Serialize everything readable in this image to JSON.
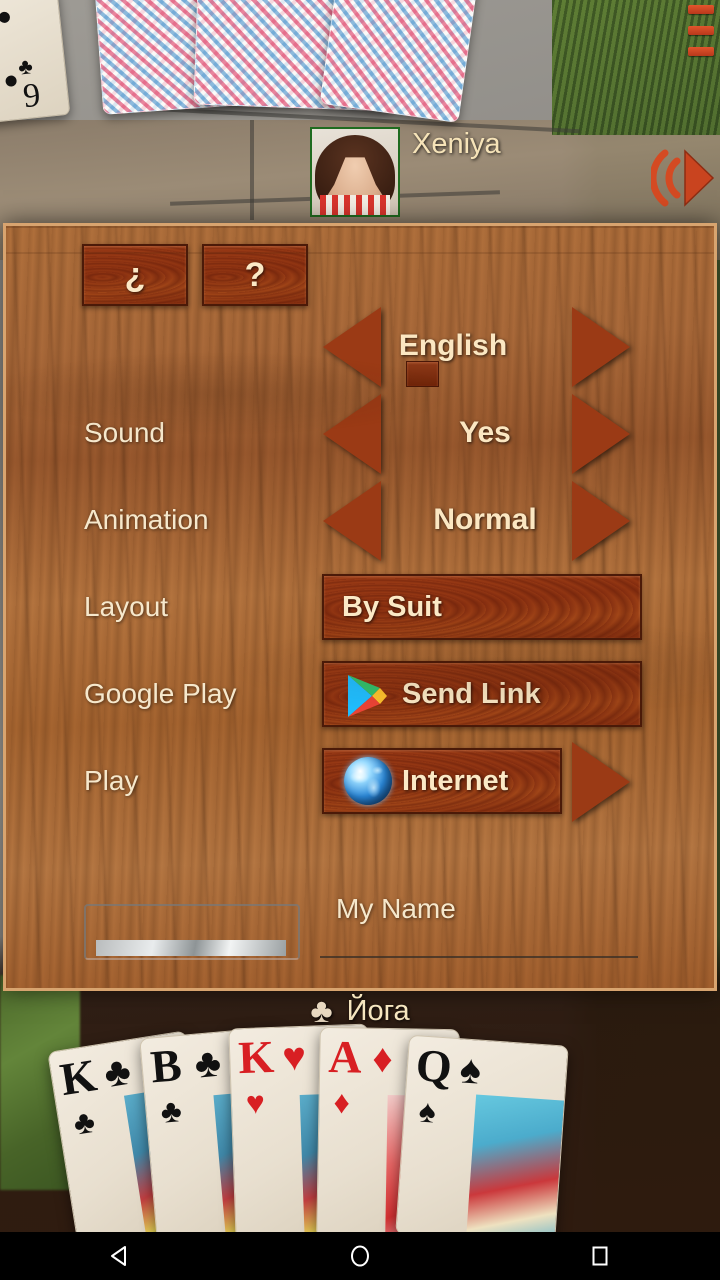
{
  "app": {
    "opponent": {
      "name": "Xeniya"
    },
    "my_player": {
      "suit_glyph": "♣",
      "nickname": "Йога"
    },
    "icons": {
      "menu": "hamburger-menu-icon",
      "sound": "speaker-icon",
      "google_play": "google-play-icon",
      "globe": "globe-icon"
    }
  },
  "settings_panel": {
    "help_buttons": [
      {
        "id": "about-button",
        "label": "¿"
      },
      {
        "id": "help-button",
        "label": "?"
      }
    ],
    "rows": [
      {
        "id": "language",
        "label": "",
        "value": "English",
        "type": "stepper",
        "prev": "◀",
        "next": "▶"
      },
      {
        "id": "sound",
        "label": "Sound",
        "value": "Yes",
        "type": "stepper",
        "prev": "◀",
        "next": "▶"
      },
      {
        "id": "animation",
        "label": "Animation",
        "value": "Normal",
        "type": "stepper",
        "prev": "◀",
        "next": "▶"
      },
      {
        "id": "layout",
        "label": "Layout",
        "value": "By Suit",
        "type": "button"
      },
      {
        "id": "google-play",
        "label": "Google Play",
        "value": "Send Link",
        "type": "button-icon"
      },
      {
        "id": "play",
        "label": "Play",
        "value": "Internet",
        "type": "button-icon-arrow",
        "next": "▶"
      }
    ],
    "profile": {
      "name_label": "My Name",
      "name_value": "",
      "name_placeholder": ""
    }
  },
  "table_cards": [
    {
      "rank": "K",
      "suit": "♣",
      "color": "black"
    },
    {
      "rank": "B",
      "suit": "♣",
      "color": "black"
    },
    {
      "rank": "K",
      "suit": "♥",
      "color": "red"
    },
    {
      "rank": "A",
      "suit": "♦",
      "color": "red"
    },
    {
      "rank": "Q",
      "suit": "♠",
      "color": "black"
    }
  ],
  "navbar": {
    "back": "back-button",
    "home": "home-button",
    "recents": "recents-button"
  },
  "colors": {
    "panel_border": "#d8a46f",
    "label_text": "#f6e8cc",
    "button_wood": "#9c3c16",
    "accent_orange": "#e2552c"
  }
}
